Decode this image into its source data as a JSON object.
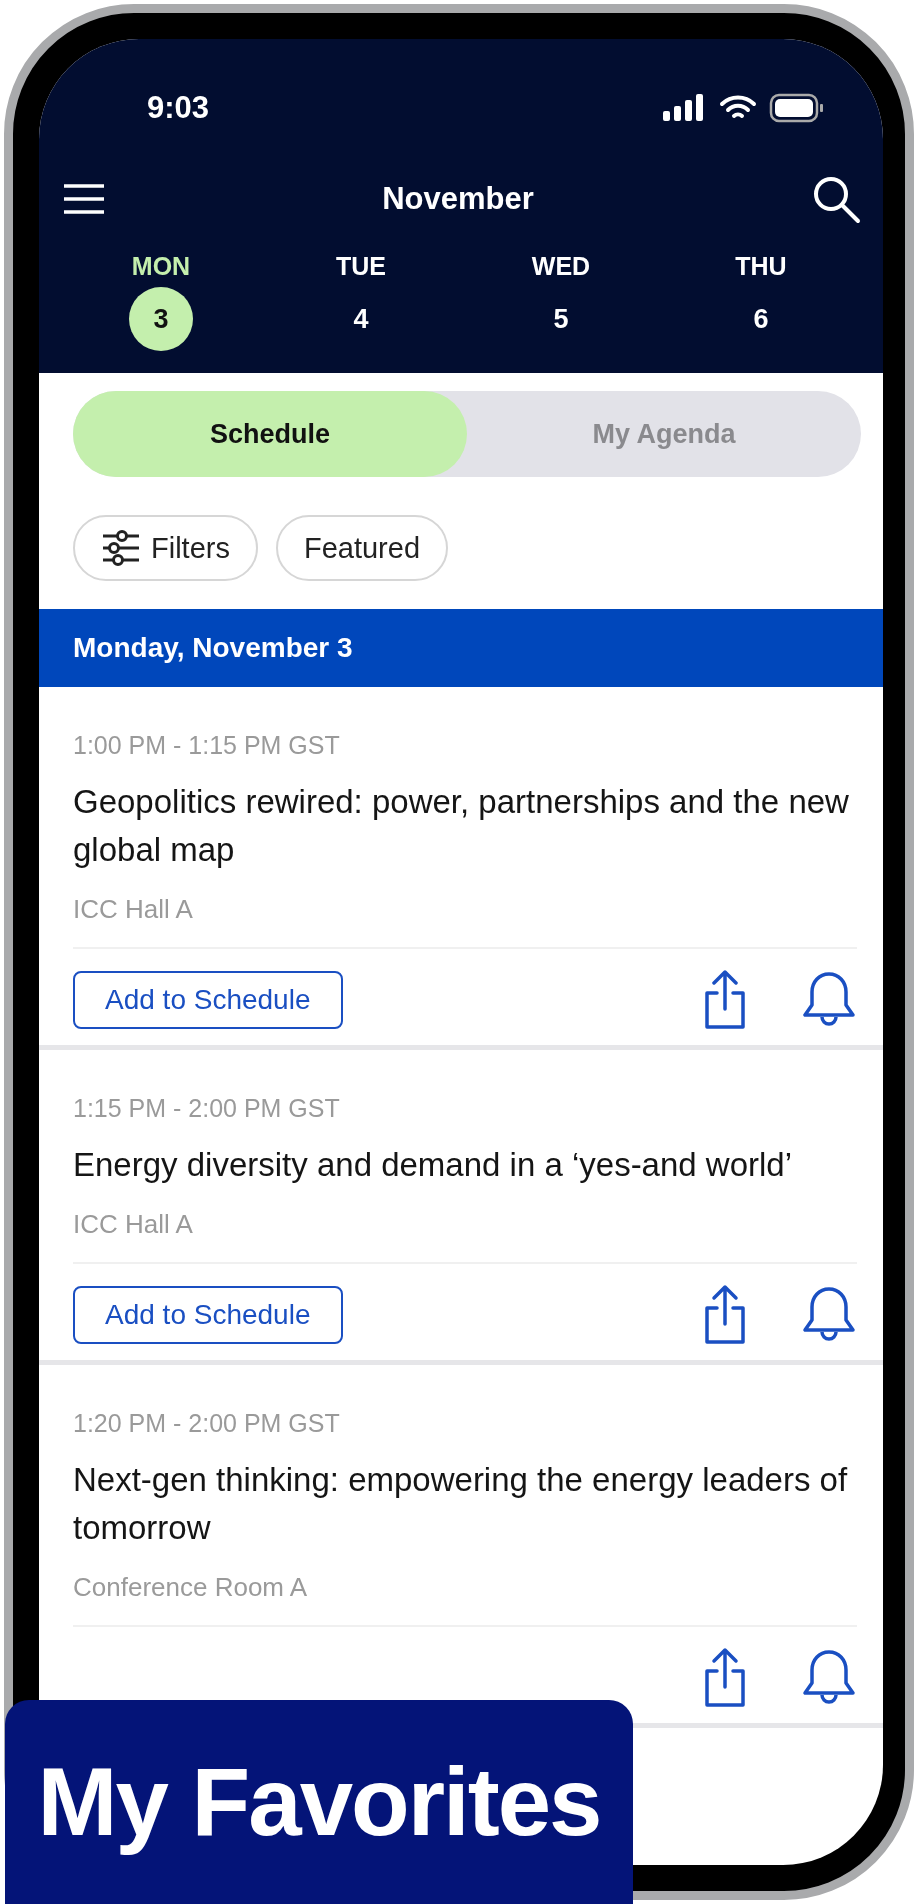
{
  "status_bar": {
    "time": "9:03"
  },
  "nav": {
    "title": "November"
  },
  "days": [
    {
      "weekday": "MON",
      "date": "3",
      "selected": true
    },
    {
      "weekday": "TUE",
      "date": "4",
      "selected": false
    },
    {
      "weekday": "WED",
      "date": "5",
      "selected": false
    },
    {
      "weekday": "THU",
      "date": "6",
      "selected": false
    }
  ],
  "tabs": [
    {
      "label": "Schedule",
      "selected": true
    },
    {
      "label": "My Agenda",
      "selected": false
    }
  ],
  "chips": [
    {
      "label": "Filters",
      "kind": "filter"
    },
    {
      "label": "Featured",
      "kind": "plain"
    }
  ],
  "section": {
    "title": "Monday, November 3"
  },
  "sessions": [
    {
      "time": "1:00 PM - 1:15 PM GST",
      "title": "Geopolitics rewired: power, partnerships and the new global map",
      "location": "ICC Hall A",
      "button": "Add to Schedule"
    },
    {
      "time": "1:15 PM - 2:00 PM GST",
      "title": "Energy diversity and demand in a ‘yes-and world’",
      "location": "ICC Hall A",
      "button": "Add to Schedule"
    },
    {
      "time": "1:20 PM - 2:00 PM GST",
      "title": "Next-gen thinking: empowering the energy leaders of tomorrow",
      "location": "Conference Room A"
    }
  ],
  "banner": {
    "text": "My Favorites"
  }
}
